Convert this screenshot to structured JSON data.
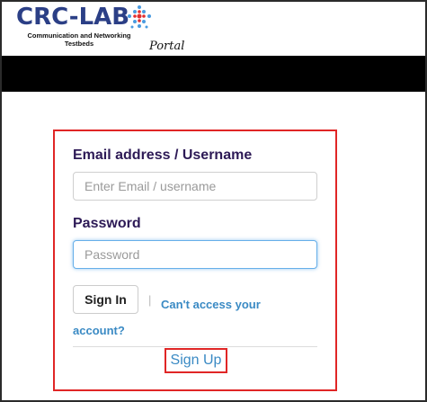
{
  "header": {
    "logo_text": "CRC-LAB",
    "logo_sub": "Communication and Networking Testbeds",
    "portal_label": "Portal",
    "logo_colors": {
      "text": "#2b3f86",
      "mark_blue": "#4a9be0",
      "mark_red": "#e23030"
    }
  },
  "login": {
    "email_label": "Email address / Username",
    "email_placeholder": "Enter Email / username",
    "email_value": "",
    "password_label": "Password",
    "password_placeholder": "Password",
    "password_value": "",
    "signin_label": "Sign In",
    "separator": "|",
    "cant_access_label": "Can't access your account?",
    "signup_label": "Sign Up"
  },
  "colors": {
    "highlight_border": "#e02626",
    "link": "#3a8ac4",
    "label": "#2d1a56",
    "topbar": "#000000"
  }
}
